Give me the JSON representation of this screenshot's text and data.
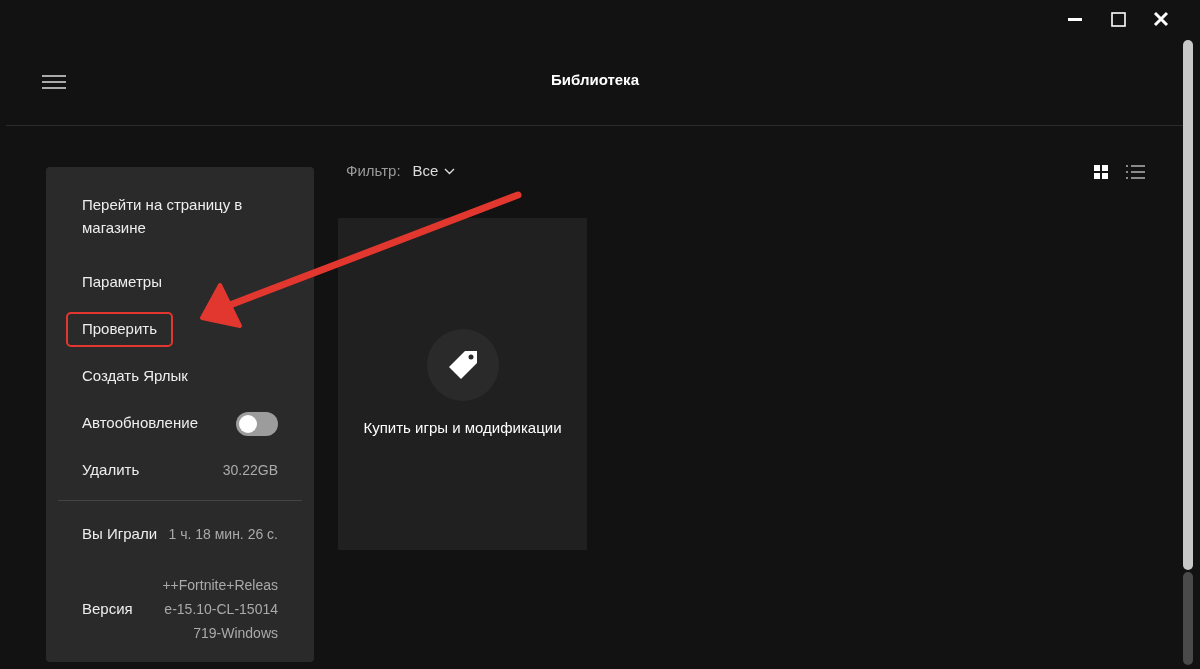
{
  "window": {
    "title": "Библиотека"
  },
  "filter": {
    "label": "Фильтр:",
    "value": "Все"
  },
  "view_modes": [
    {
      "kind": "grid",
      "selected": true
    },
    {
      "kind": "list",
      "selected": false
    }
  ],
  "store_card": {
    "label": "Купить игры и модификации"
  },
  "context_menu": {
    "items": [
      {
        "kind": "link",
        "label": "Перейти на страницу в магазине",
        "highlighted": false
      },
      {
        "kind": "link",
        "label": "Параметры",
        "highlighted": false
      },
      {
        "kind": "link",
        "label": "Проверить",
        "highlighted": true
      },
      {
        "kind": "link",
        "label": "Создать Ярлык",
        "highlighted": false
      },
      {
        "kind": "toggle",
        "label": "Автообновление",
        "on": false
      },
      {
        "kind": "value",
        "label": "Удалить",
        "value": "30.22GB"
      }
    ],
    "info": [
      {
        "label": "Вы Играли",
        "value": "1 ч. 18 мин. 26 с."
      },
      {
        "label": "Версия",
        "value": "++Fortnite+Release-15.10-CL-15014719-Windows"
      }
    ]
  }
}
